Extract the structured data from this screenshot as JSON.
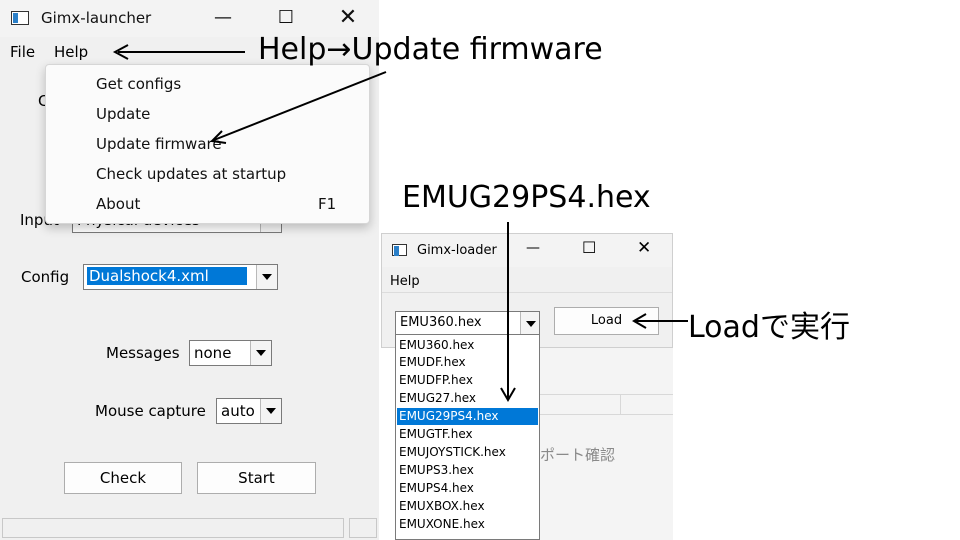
{
  "launcher": {
    "title": "Gimx-launcher",
    "menu": {
      "file": "File",
      "help": "Help"
    },
    "help_dropdown": {
      "items": [
        {
          "label": "Get configs",
          "shortcut": ""
        },
        {
          "label": "Update",
          "shortcut": ""
        },
        {
          "label": "Update firmware",
          "shortcut": ""
        },
        {
          "label": "Check updates at startup",
          "shortcut": ""
        },
        {
          "label": "About",
          "shortcut": "F1"
        }
      ]
    },
    "partial_label": "C",
    "input_label": "Input",
    "input_value": "Physical devices",
    "config_label": "Config",
    "config_value": "Dualshock4.xml",
    "messages_label": "Messages",
    "messages_value": "none",
    "mouse_capture_label": "Mouse capture",
    "mouse_capture_value": "auto",
    "check_button": "Check",
    "start_button": "Start"
  },
  "loader": {
    "title": "Gimx-loader",
    "menu": {
      "help": "Help"
    },
    "selected_file": "EMU360.hex",
    "load_button": "Load",
    "files": [
      "EMU360.hex",
      "EMUDF.hex",
      "EMUDFP.hex",
      "EMUG27.hex",
      "EMUG29PS4.hex",
      "EMUGTF.hex",
      "EMUJOYSTICK.hex",
      "EMUPS3.hex",
      "EMUPS4.hex",
      "EMUXBOX.hex",
      "EMUXONE.hex"
    ],
    "highlighted_file": "EMUG29PS4.hex",
    "background_text": "ポート確認"
  },
  "annotations": {
    "help_path": "Help→Update firmware",
    "target_file": "EMUG29PS4.hex",
    "load_note": "Loadで実行"
  },
  "colors": {
    "selection": "#0078d7",
    "window_bg": "#f0f0f0"
  }
}
